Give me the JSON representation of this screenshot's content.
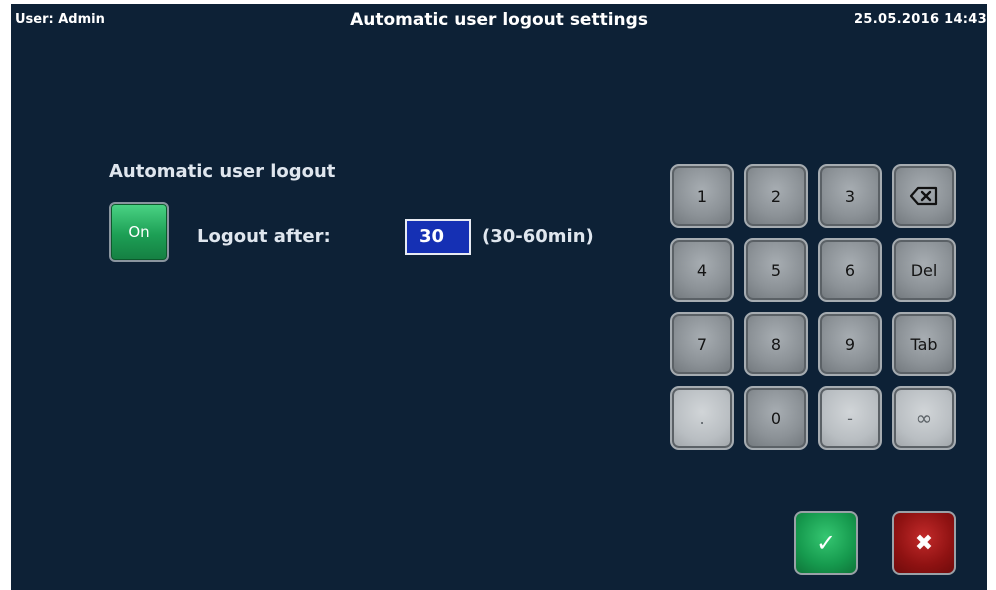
{
  "header": {
    "user_label": "User: Admin",
    "title": "Automatic user logout settings",
    "datetime": "25.05.2016  14:43"
  },
  "logout": {
    "section_title": "Automatic user logout",
    "toggle_label": "On",
    "after_label": "Logout after:",
    "minutes_value": "30",
    "range_hint": "(30-60min)"
  },
  "keypad": {
    "k1": "1",
    "k2": "2",
    "k3": "3",
    "backspace_icon": "backspace-icon",
    "k4": "4",
    "k5": "5",
    "k6": "6",
    "del": "Del",
    "k7": "7",
    "k8": "8",
    "k9": "9",
    "tab": "Tab",
    "dot": ".",
    "k0": "0",
    "minus": "-",
    "infinity": "∞"
  },
  "actions": {
    "confirm_icon": "check-icon",
    "cancel_icon": "close-icon"
  },
  "colors": {
    "background": "#0d2136",
    "field_blue": "#1530b4",
    "confirm_green": "#169a4e",
    "cancel_red": "#8f1212"
  }
}
